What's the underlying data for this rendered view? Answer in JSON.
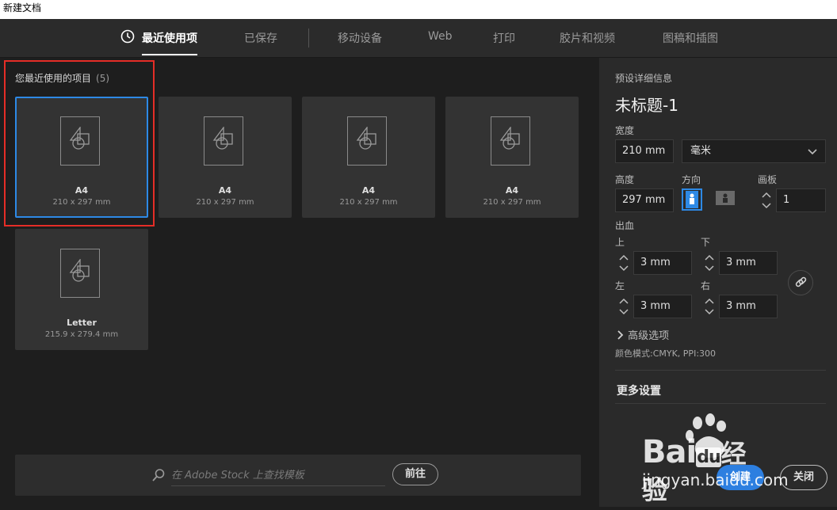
{
  "window": {
    "title": "新建文档"
  },
  "tabs": [
    {
      "label": "最近使用项",
      "active": true
    },
    {
      "label": "已保存"
    },
    {
      "label": "移动设备"
    },
    {
      "label": "Web"
    },
    {
      "label": "打印"
    },
    {
      "label": "胶片和视频"
    },
    {
      "label": "图稿和插图"
    }
  ],
  "recent": {
    "heading": "您最近使用的项目",
    "count": "(5)",
    "items": [
      {
        "name": "A4",
        "dims": "210 x 297 mm"
      },
      {
        "name": "A4",
        "dims": "210 x 297 mm"
      },
      {
        "name": "A4",
        "dims": "210 x 297 mm"
      },
      {
        "name": "A4",
        "dims": "210 x 297 mm"
      },
      {
        "name": "Letter",
        "dims": "215.9 x 279.4 mm"
      }
    ]
  },
  "stock": {
    "placeholder": "在 Adobe Stock 上查找模板",
    "go_label": "前往"
  },
  "details": {
    "section_label": "预设详细信息",
    "doc_name": "未标题-1",
    "width_label": "宽度",
    "width_value": "210 mm",
    "unit_value": "毫米",
    "height_label": "高度",
    "height_value": "297 mm",
    "orientation_label": "方向",
    "artboards_label": "画板",
    "artboards_value": "1",
    "bleed_label": "出血",
    "top_label": "上",
    "top_value": "3 mm",
    "bottom_label": "下",
    "bottom_value": "3 mm",
    "left_label": "左",
    "left_value": "3 mm",
    "right_label": "右",
    "right_value": "3 mm",
    "advanced_label": "高级选项",
    "color_mode": "颜色模式:CMYK, PPI:300",
    "more_settings": "更多设置",
    "create_label": "创建",
    "close_label": "关闭"
  },
  "watermark": {
    "brand": "Bai",
    "brand2": "du",
    "brand3": "经验",
    "url": "jingyan.baidu.com"
  },
  "colors": {
    "accent": "#2d89e5",
    "highlight": "#e52d27"
  }
}
